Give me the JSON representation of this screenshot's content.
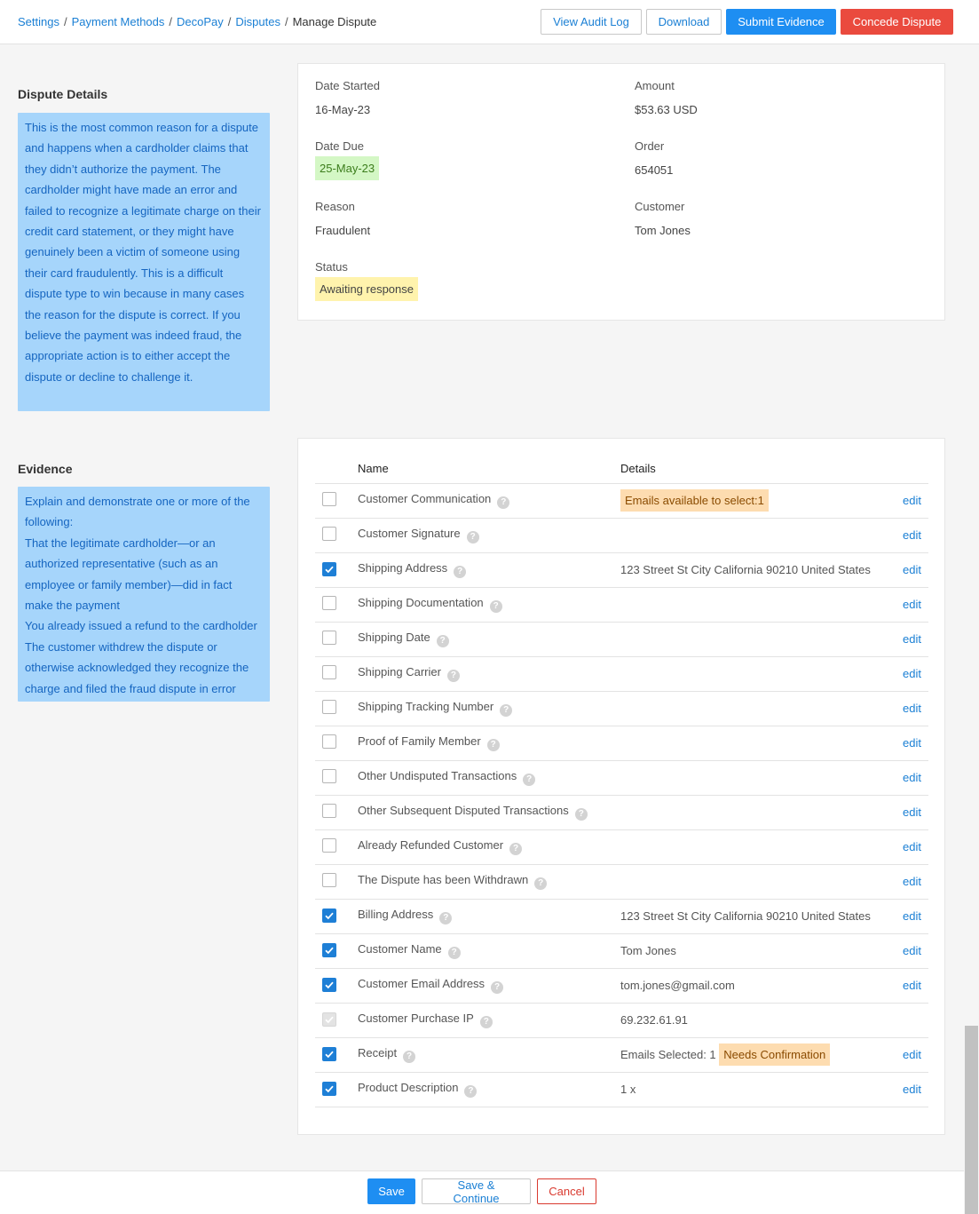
{
  "breadcrumb": {
    "items": [
      "Settings",
      "Payment Methods",
      "DecoPay",
      "Disputes"
    ],
    "current": "Manage Dispute",
    "separator": "/"
  },
  "toolbar": {
    "audit_label": "View Audit Log",
    "download_label": "Download",
    "submit_label": "Submit Evidence",
    "concede_label": "Concede Dispute"
  },
  "dispute_details": {
    "title": "Dispute Details",
    "description": "This is the most common reason for a dispute and happens when a cardholder claims that they didn’t authorize the payment. The cardholder might have made an error and failed to recognize a legitimate charge on their credit card statement, or they might have genuinely been a victim of someone using their card fraudulently. This is a difficult dispute type to win because in many cases the reason for the dispute is correct. If you believe the payment was indeed fraud, the appropriate action is to either accept the dispute or decline to challenge it.",
    "fields": {
      "date_started_label": "Date Started",
      "date_started": "16-May-23",
      "amount_label": "Amount",
      "amount": "$53.63 USD",
      "date_due_label": "Date Due",
      "date_due": "25-May-23",
      "order_label": "Order",
      "order": "654051",
      "reason_label": "Reason",
      "reason": "Fraudulent",
      "customer_label": "Customer",
      "customer": "Tom Jones",
      "status_label": "Status",
      "status": "Awaiting response"
    }
  },
  "evidence": {
    "title": "Evidence",
    "description_lines": [
      "Explain and demonstrate one or more of the following:",
      "That the legitimate cardholder—or an authorized representative (such as an employee or family member)—did in fact make the payment",
      "You already issued a refund to the cardholder",
      "The customer withdrew the dispute or otherwise acknowledged they recognize the charge and filed the fraud dispute in error"
    ],
    "columns": {
      "name": "Name",
      "details": "Details"
    },
    "edit_label": "edit",
    "help_glyph": "?",
    "rows": [
      {
        "name": "Customer Communication",
        "checked": false,
        "disabled": false,
        "details": "",
        "badge": "Emails available to select:1",
        "editable": true
      },
      {
        "name": "Customer Signature",
        "checked": false,
        "disabled": false,
        "details": "",
        "badge": "",
        "editable": true
      },
      {
        "name": "Shipping Address",
        "checked": true,
        "disabled": false,
        "details": "123 Street St City California 90210 United States",
        "badge": "",
        "editable": true
      },
      {
        "name": "Shipping Documentation",
        "checked": false,
        "disabled": false,
        "details": "",
        "badge": "",
        "editable": true
      },
      {
        "name": "Shipping Date",
        "checked": false,
        "disabled": false,
        "details": "",
        "badge": "",
        "editable": true
      },
      {
        "name": "Shipping Carrier",
        "checked": false,
        "disabled": false,
        "details": "",
        "badge": "",
        "editable": true
      },
      {
        "name": "Shipping Tracking Number",
        "checked": false,
        "disabled": false,
        "details": "",
        "badge": "",
        "editable": true
      },
      {
        "name": "Proof of Family Member",
        "checked": false,
        "disabled": false,
        "details": "",
        "badge": "",
        "editable": true
      },
      {
        "name": "Other Undisputed Transactions",
        "checked": false,
        "disabled": false,
        "details": "",
        "badge": "",
        "editable": true
      },
      {
        "name": "Other Subsequent Disputed Transactions",
        "checked": false,
        "disabled": false,
        "details": "",
        "badge": "",
        "editable": true
      },
      {
        "name": "Already Refunded Customer",
        "checked": false,
        "disabled": false,
        "details": "",
        "badge": "",
        "editable": true
      },
      {
        "name": "The Dispute has been Withdrawn",
        "checked": false,
        "disabled": false,
        "details": "",
        "badge": "",
        "editable": true
      },
      {
        "name": "Billing Address",
        "checked": true,
        "disabled": false,
        "details": "123 Street St City California 90210 United States",
        "badge": "",
        "editable": true
      },
      {
        "name": "Customer Name",
        "checked": true,
        "disabled": false,
        "details": "Tom Jones",
        "badge": "",
        "editable": true
      },
      {
        "name": "Customer Email Address",
        "checked": true,
        "disabled": false,
        "details": "tom.jones@gmail.com",
        "badge": "",
        "editable": true
      },
      {
        "name": "Customer Purchase IP",
        "checked": true,
        "disabled": true,
        "details": "69.232.61.91",
        "badge": "",
        "editable": false
      },
      {
        "name": "Receipt",
        "checked": true,
        "disabled": false,
        "details": "Emails Selected: 1",
        "badge": "Needs Confirmation",
        "editable": true
      },
      {
        "name": "Product Description",
        "checked": true,
        "disabled": false,
        "details": "1 x",
        "badge": "",
        "editable": true
      }
    ]
  },
  "footer": {
    "save_label": "Save",
    "save_continue_label": "Save & Continue",
    "cancel_label": "Cancel"
  },
  "colors": {
    "link": "#1a7fd4",
    "primary": "#1e8ef2",
    "danger": "#ea4a3e",
    "info_box_bg": "#a6d5fb",
    "due_date_bg": "#d4f7c5",
    "status_bg": "#fff3ad",
    "badge_bg": "#fddcb0"
  }
}
